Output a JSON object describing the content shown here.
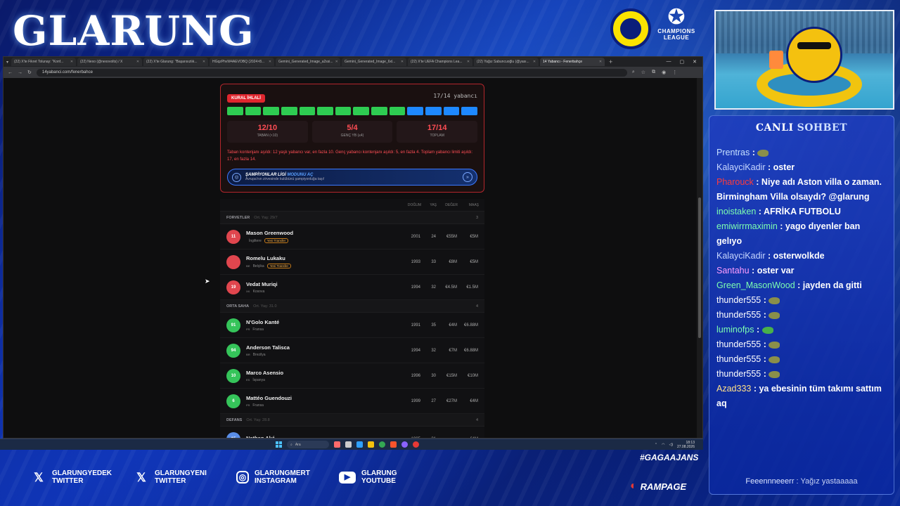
{
  "overlay": {
    "brand": "GLARUNG",
    "ucl_text": "CHAMPIONS LEAGUE",
    "hashtag": "#GAGAAJANS",
    "sponsor": "RAMPAGE",
    "socials": [
      {
        "icon": "x-icon",
        "handle": "GLARUNGYEDEK",
        "platform": "TWITTER"
      },
      {
        "icon": "x-icon",
        "handle": "GLARUNGYENI",
        "platform": "TWITTER"
      },
      {
        "icon": "instagram-icon",
        "handle": "GLARUNGMERT",
        "platform": "INSTAGRAM"
      },
      {
        "icon": "youtube-icon",
        "handle": "GLARUNG",
        "platform": "YOUTUBE"
      }
    ]
  },
  "browser": {
    "tabs": [
      {
        "label": "(22) X'te Fikret Tolunay: \"Konf...",
        "active": false
      },
      {
        "label": "(22) Nexo (@nexovolts) / X",
        "active": false
      },
      {
        "label": "(22) X'te Glarung: \"Başarısızlık...",
        "active": false
      },
      {
        "label": "HGqzPhvW4AEVOBQ (2024×8...",
        "active": false
      },
      {
        "label": "Gemini_Generated_Image_a2ssi...",
        "active": false
      },
      {
        "label": "Gemini_Generated_Image_6xl...",
        "active": false
      },
      {
        "label": "(22) X'te UEFA Champions Lea...",
        "active": false
      },
      {
        "label": "(22) Yağız Sabuncuoğlu (@yası...",
        "active": false
      },
      {
        "label": "14 Yabancı - Fenerbahçe",
        "active": true
      }
    ],
    "url": "14yabanci.com/fenerbahce"
  },
  "rule": {
    "badge": "KURAL İHLALİ",
    "ratio": "17/14 yabancı",
    "bars": [
      "#2ecc52",
      "#2ecc52",
      "#2ecc52",
      "#2ecc52",
      "#2ecc52",
      "#2ecc52",
      "#2ecc52",
      "#2ecc52",
      "#2ecc52",
      "#2ecc52",
      "#1e88ff",
      "#1e88ff",
      "#1e88ff",
      "#1e88ff"
    ],
    "stats": [
      {
        "value": "12/10",
        "label": "TABAN (<10)"
      },
      {
        "value": "5/4",
        "label": "GENÇ YB (≤4)"
      },
      {
        "value": "17/14",
        "label": "TOPLAM"
      }
    ],
    "message": "Taban kontenjanı aşıldı: 12 yaşlı yabancı var, en fazla 10. Genç yabancı kontenjanı aşıldı: 5, en fazla 4. Toplam yabancı limiti aşıldı: 17, en fazla 14.",
    "ucl_button": {
      "title_a": "ŞAMPİYONLAR LİGİ",
      "title_b": "MODUNU AÇ",
      "subtitle": "Avrupa'nın zirvesinde kulübünü şampiyonluğa taşı!"
    }
  },
  "table": {
    "headers": [
      "DOĞUM",
      "YAŞ",
      "DEĞER",
      "MAAŞ"
    ],
    "sections": [
      {
        "name": "FORVETLER",
        "sub": "Ort. Yaş: 29/7",
        "count": "3"
      },
      {
        "name": "ORTA SAHA",
        "sub": "Ort. Yaş: 31.0",
        "count": "4"
      },
      {
        "name": "DEFANS",
        "sub": "Ort. Yaş: 28.8",
        "count": "4"
      }
    ],
    "forwards": [
      {
        "num": "11",
        "name": "Mason Greenwood",
        "flag": "",
        "country": "İngiltere",
        "tag": "Yeni Transfer",
        "birth": "2001",
        "age": "24",
        "value": "€55M",
        "wage": "€5M",
        "color": "#e0464e"
      },
      {
        "num": "",
        "name": "Romelu Lukaku",
        "flag": "BE",
        "country": "Belçika",
        "tag": "Yeni Transfer",
        "birth": "1993",
        "age": "33",
        "value": "€8M",
        "wage": "€5M",
        "color": "#e0464e"
      },
      {
        "num": "19",
        "name": "Vedat Muriqi",
        "flag": "XK",
        "country": "Kosova",
        "tag": "",
        "birth": "1994",
        "age": "32",
        "value": "€4.5M",
        "wage": "€1.5M",
        "color": "#e0464e"
      }
    ],
    "midfield": [
      {
        "num": "91",
        "name": "N'Golo Kanté",
        "flag": "FR",
        "country": "Fransa",
        "tag": "",
        "birth": "1991",
        "age": "35",
        "value": "€4M",
        "wage": "€6.88M",
        "color": "#35c45a"
      },
      {
        "num": "94",
        "name": "Anderson Talisca",
        "flag": "BR",
        "country": "Brezilya",
        "tag": "",
        "birth": "1994",
        "age": "32",
        "value": "€7M",
        "wage": "€6.88M",
        "color": "#35c45a"
      },
      {
        "num": "10",
        "name": "Marco Asensio",
        "flag": "ES",
        "country": "İspanya",
        "tag": "",
        "birth": "1996",
        "age": "30",
        "value": "€15M",
        "wage": "€10M",
        "color": "#35c45a"
      },
      {
        "num": "6",
        "name": "Mattéo Guendouzi",
        "flag": "FR",
        "country": "Fransa",
        "tag": "",
        "birth": "1999",
        "age": "27",
        "value": "€27M",
        "wage": "€4M",
        "color": "#35c45a"
      }
    ],
    "defense": [
      {
        "num": "15",
        "name": "Nathan Aké",
        "flag": "",
        "country": "",
        "tag": "",
        "birth": "1995",
        "age": "31",
        "value": "–",
        "wage": "€4M",
        "color": "#5a8ee8"
      }
    ]
  },
  "taskbar": {
    "search": "Ara",
    "time": "18:13",
    "date": "27.08.2026"
  },
  "chat": {
    "title_a": "CANLI",
    "title_b": "SOHBET",
    "messages": [
      {
        "user": "Prentras",
        "color": "#c6e0ff",
        "text": "",
        "emote": true
      },
      {
        "user": "KalayciKadir",
        "color": "#c6d6ff",
        "text": "oster",
        "emote": false
      },
      {
        "user": "Pharouck",
        "color": "#ff3b3b",
        "text": "Niye adı Aston villa o zaman. Birmingham Villa olsaydı? @glarung",
        "emote": false
      },
      {
        "user": "inoistaken",
        "color": "#7dffb0",
        "text": "AFRİKA FUTBOLU",
        "emote": false
      },
      {
        "user": "emiwirrmaximin",
        "color": "#7dffb0",
        "text": "yago dıyenler ban gelıyo",
        "emote": false
      },
      {
        "user": "KalayciKadir",
        "color": "#c6d6ff",
        "text": "osterwolkde",
        "emote": false
      },
      {
        "user": "Santahu",
        "color": "#ff9eff",
        "text": "oster var",
        "emote": false
      },
      {
        "user": "Green_MasonWood",
        "color": "#7dffb0",
        "text": "jayden da gitti",
        "emote": false
      },
      {
        "user": "thunder555",
        "color": "#ffffff",
        "text": "",
        "emote": true
      },
      {
        "user": "thunder555",
        "color": "#ffffff",
        "text": "",
        "emote": true
      },
      {
        "user": "luminofps",
        "color": "#7dffb0",
        "text": "",
        "emote": true
      },
      {
        "user": "thunder555",
        "color": "#ffffff",
        "text": "",
        "emote": true
      },
      {
        "user": "thunder555",
        "color": "#ffffff",
        "text": "",
        "emote": true
      },
      {
        "user": "thunder555",
        "color": "#ffffff",
        "text": "",
        "emote": true
      },
      {
        "user": "Azad333",
        "color": "#ffe08a",
        "text": "ya ebesinin tüm takımı sattım aq",
        "emote": false
      }
    ],
    "last_user": "Feeennneeerr",
    "last_text": "Yağız yastaaaaa"
  }
}
